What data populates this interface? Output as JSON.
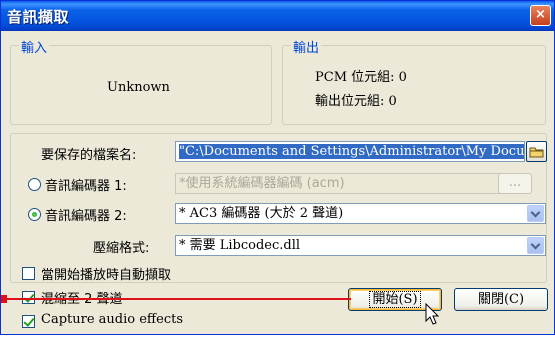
{
  "window": {
    "title": "音訊擷取",
    "close_glyph": "×"
  },
  "input_group": {
    "legend": "輸入",
    "value": "Unknown"
  },
  "output_group": {
    "legend": "輸出",
    "pcm_bytes": "PCM 位元組: 0",
    "output_bytes": "輸出位元組: 0"
  },
  "filename": {
    "label": "要保存的檔案名:",
    "value": "\"C:\\Documents and Settings\\Administrator\\My Docu"
  },
  "encoder1": {
    "label": "音訊編碼器 1:",
    "value": "*使用系統編碼器編碼 (acm)",
    "extra_button": "...",
    "selected": false
  },
  "encoder2": {
    "label": "音訊編碼器 2:",
    "value": "* AC3 編碼器 (大於 2 聲道)",
    "selected": true
  },
  "compress": {
    "label": "壓縮格式:",
    "value": "* 需要 Libcodec.dll"
  },
  "options": {
    "auto_capture": {
      "label": "當開始播放時自動擷取",
      "checked": false
    },
    "downmix": {
      "label": "混縮至 2 聲道",
      "checked": true
    },
    "capture_effects": {
      "label": "Capture audio effects",
      "checked": true
    }
  },
  "buttons": {
    "start": "開始(S)",
    "close": "關閉(C)"
  },
  "colors": {
    "accent": "#0046D5",
    "pointer": "#E0101A"
  }
}
